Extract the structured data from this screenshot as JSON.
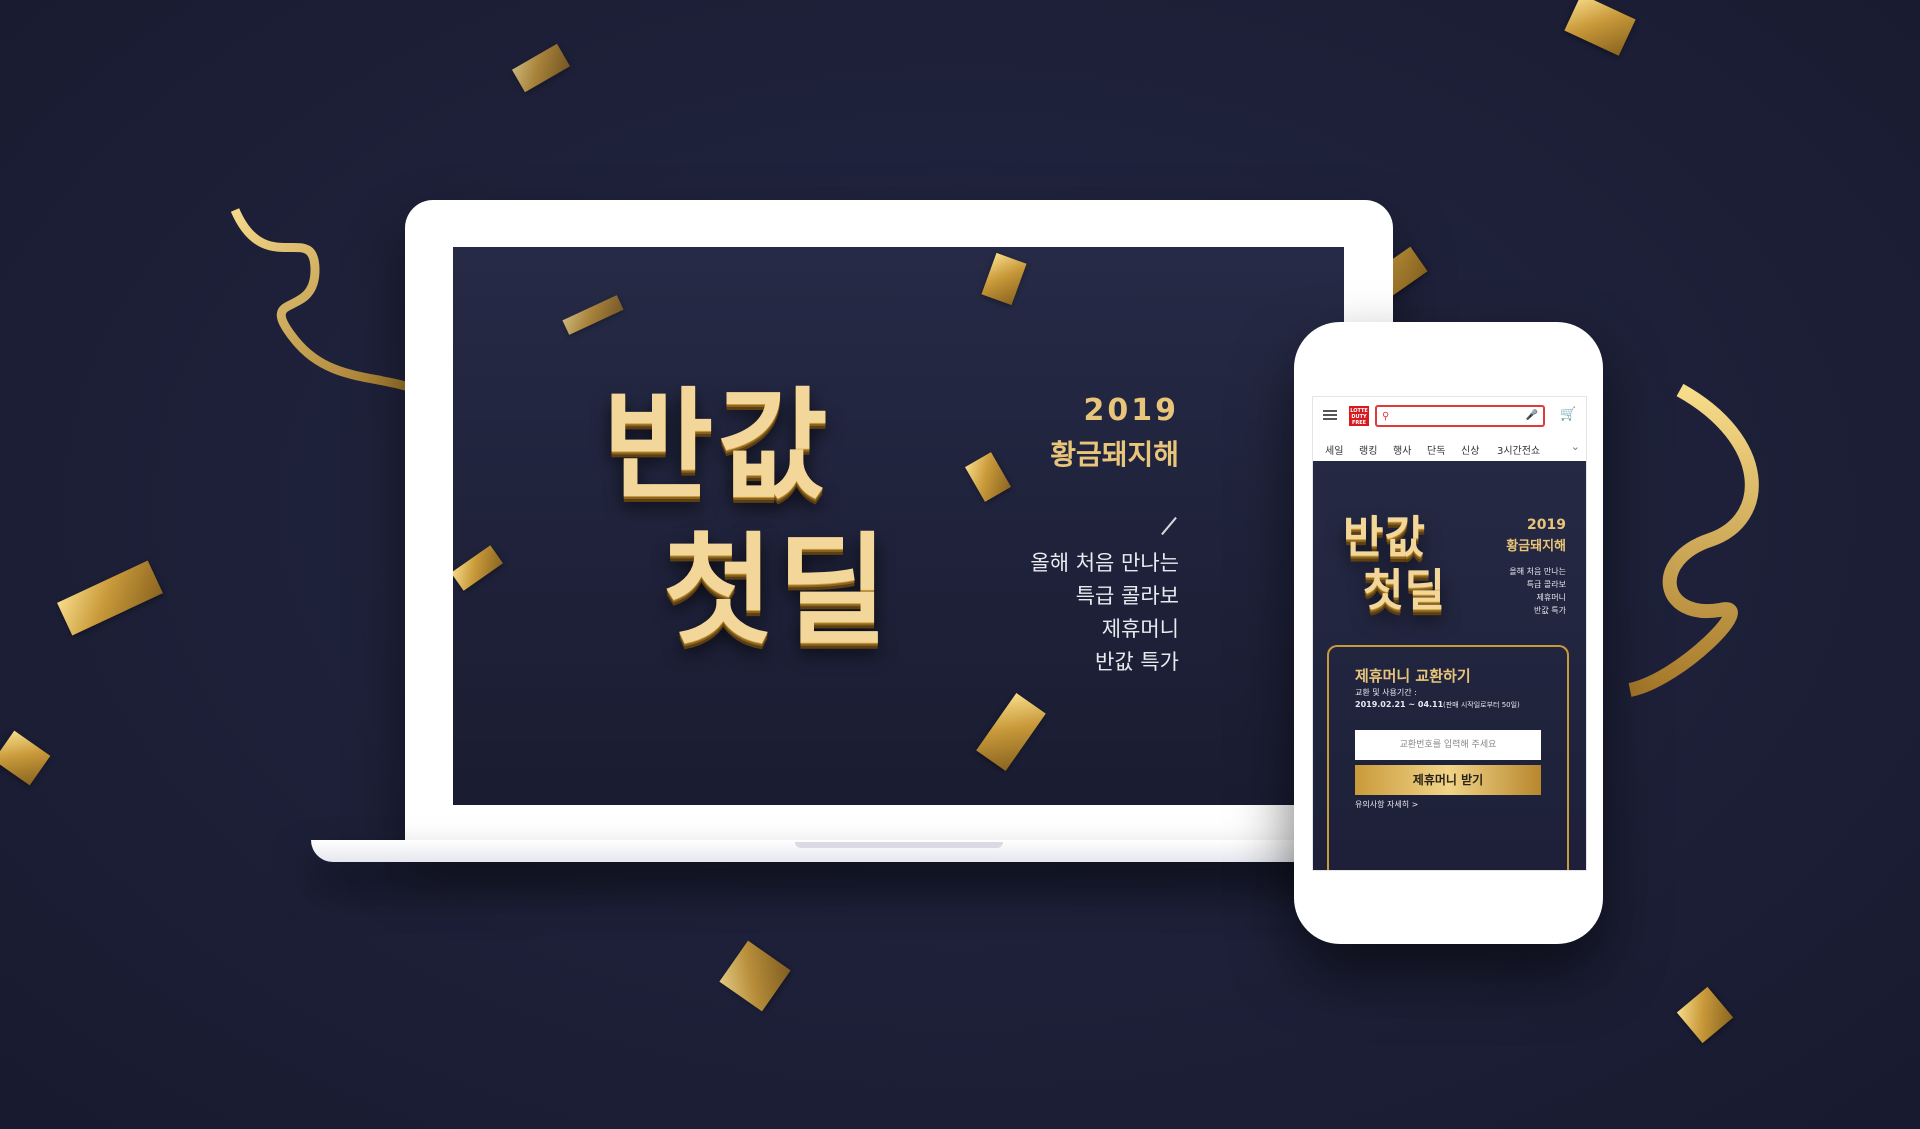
{
  "desktop": {
    "headline_line1": "반값",
    "headline_line2": "첫딜",
    "year": "2019",
    "year_subtitle": "황금돼지해",
    "desc_lines": [
      "올해 처음 만나는",
      "특급 콜라보",
      "제휴머니",
      "반값 특가"
    ]
  },
  "mobile": {
    "logo_text": "LOTTE DUTY FREE",
    "search": {
      "placeholder": ""
    },
    "nav": [
      "세일",
      "랭킹",
      "행사",
      "단독",
      "신상",
      "3시간전쇼"
    ],
    "banner": {
      "headline_line1": "반값",
      "headline_line2": "첫딜",
      "year": "2019",
      "year_subtitle": "황금돼지해",
      "desc_lines": [
        "올해 처음 만나는",
        "특급 콜라보",
        "제휴머니",
        "반값 특가"
      ]
    },
    "ticket": {
      "title": "제휴머니 교환하기",
      "period_label": "교환 및 사용기간 :",
      "period_value": "2019.02.21 ~ 04.11",
      "period_note": "(판매 시작일로부터 50일)",
      "input_placeholder": "교환번호를 입력해 주세요",
      "button_label": "제휴머니 받기",
      "notice_link": "유의사항 자세히 >"
    }
  },
  "colors": {
    "background": "#1d2038",
    "gold": "#e9c57a",
    "brand_red": "#d71920"
  }
}
